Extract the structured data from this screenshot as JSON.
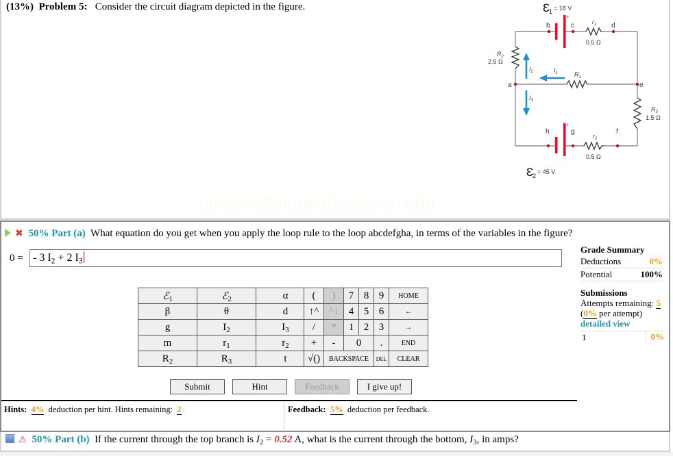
{
  "problem": {
    "weight": "(13%)",
    "title": "Problem 5:",
    "prompt": "Consider the circuit diagram depicted in the figure."
  },
  "watermark": "gbracel@students.towson.edu",
  "circuit": {
    "emf1": "= 18 V",
    "emf2": "= 45 V",
    "r1_label": "r",
    "r1_value": "0.5 Ω",
    "r2_value": "0.5 Ω",
    "R2_value": "2.5 Ω",
    "R3_value": "1.5 Ω",
    "nodes": [
      "a",
      "b",
      "c",
      "d",
      "e",
      "f",
      "g",
      "h"
    ],
    "currents": [
      "I1",
      "I2",
      "I3"
    ]
  },
  "part_a": {
    "weight": "50%",
    "label": "Part (a)",
    "question": "What equation do you get when you apply the loop rule to the loop abcdefgha, in terms of the variables in the figure?",
    "eq_prefix": "0 =",
    "answer_value": "- 3 I2 + 2 I3"
  },
  "grade_summary": {
    "title": "Grade Summary",
    "deductions_label": "Deductions",
    "deductions_value": "0%",
    "potential_label": "Potential",
    "potential_value": "100%"
  },
  "submissions": {
    "title": "Submissions",
    "attempts_label": "Attempts remaining:",
    "attempts_value": "5",
    "per_attempt_pct": "0%",
    "per_attempt_text": "per attempt)",
    "detailed_view": "detailed view",
    "rows": [
      {
        "n": "1",
        "pct": "0%"
      }
    ]
  },
  "variable_keys": [
    [
      "ℰ1",
      "ℰ2",
      "α"
    ],
    [
      "β",
      "θ",
      "d"
    ],
    [
      "g",
      "I2",
      "I3"
    ],
    [
      "m",
      "r1",
      "r2"
    ],
    [
      "R2",
      "R3",
      "t"
    ]
  ],
  "keypad": {
    "row1": [
      "(",
      ")",
      "7",
      "8",
      "9",
      "HOME"
    ],
    "row2": [
      "↑^",
      "^↓",
      "4",
      "5",
      "6",
      "←"
    ],
    "row3": [
      "/",
      "*",
      "1",
      "2",
      "3",
      "→"
    ],
    "row4": [
      "+",
      "-",
      "0",
      ".",
      "END"
    ],
    "row5": [
      "√()",
      "BACKSPACE",
      "DEL",
      "CLEAR"
    ]
  },
  "buttons": {
    "submit": "Submit",
    "hint": "Hint",
    "feedback": "Feedback",
    "give_up": "I give up!"
  },
  "hints": {
    "label": "Hints:",
    "pct": "4%",
    "text": "deduction per hint. Hints remaining:",
    "remaining": "2"
  },
  "feedback": {
    "label": "Feedback:",
    "pct": "5%",
    "text": "deduction per feedback."
  },
  "part_b": {
    "weight": "50%",
    "label": "Part (b)",
    "q1": "If the current through the top branch is",
    "var": "I",
    "var_sub": "2",
    "eq": "=",
    "value": "0.52",
    "q2": "A, what is the current through the bottom,",
    "var2_sub": "3",
    "q3": ", in amps?"
  }
}
